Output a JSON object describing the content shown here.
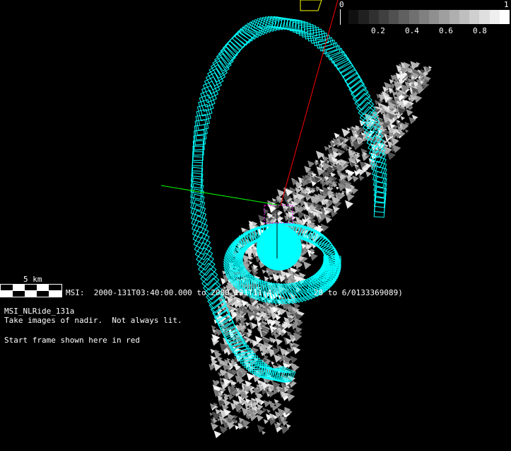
{
  "colorbar": {
    "min_label": "0",
    "max_label": "1",
    "ticks": [
      "0.2",
      "0.4",
      "0.6",
      "0.8"
    ]
  },
  "scale_bar": {
    "label": "5 km"
  },
  "msi_line": "MSI:  2000-131T03:40:00.000 to 2000-131T11:4",
  "msi_line_end": "28 to 6/0133369089)",
  "sequence": {
    "name": "MSI_NLRide_131a",
    "description": "Take images of nadir.  Not always lit.",
    "note": "Start frame shown here in red"
  },
  "colors": {
    "footprint": "#00ffff",
    "start_frame": "#ff0000",
    "axis_x": "#00ff00",
    "axis_z": "#ff0000",
    "highlight": "#ff00ff",
    "yellow": "#ffff00"
  }
}
